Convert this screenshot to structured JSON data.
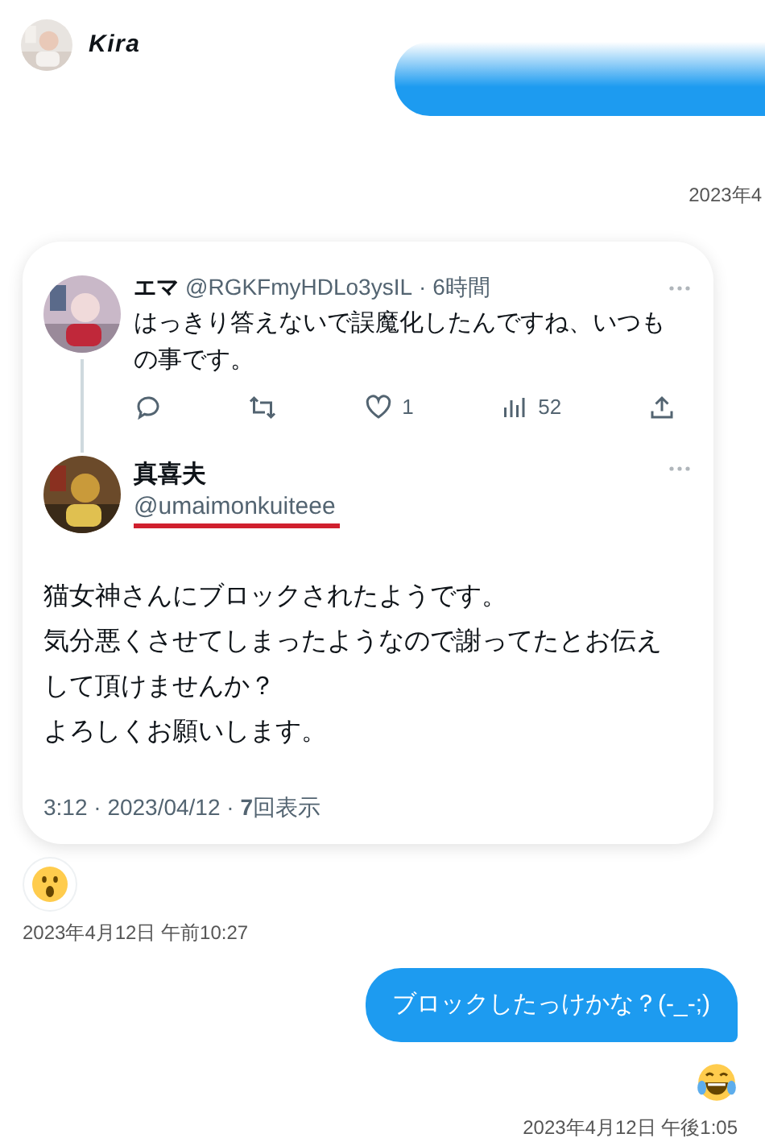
{
  "header": {
    "name": "Kira"
  },
  "top_timestamp": "2023年4",
  "quoted_thread": {
    "reply": {
      "display_name": "エマ",
      "handle": "@RGKFmyHDLo3ysIL",
      "time": "· 6時間",
      "text": "はっきり答えないで誤魔化したんですね、いつもの事です。",
      "likes": "1",
      "views": "52"
    },
    "tweet": {
      "display_name": "真喜夫",
      "handle": "@umaimonkuiteee",
      "lines": [
        "猫女神さんにブロックされたようです。",
        "気分悪くさせてしまったようなので謝ってたとお伝えして頂けませんか？",
        "よろしくお願いします。"
      ],
      "meta": "3:12 · 2023/04/12 · **7**回表示"
    }
  },
  "messages": [
    {
      "kind": "reaction",
      "timestamp": "2023年4月12日 午前10:27"
    },
    {
      "kind": "sent",
      "text": "ブロックしたっけかな？(-_-;)"
    },
    {
      "kind": "sent_reaction",
      "timestamp": "2023年4月12日 午後1:05"
    }
  ]
}
